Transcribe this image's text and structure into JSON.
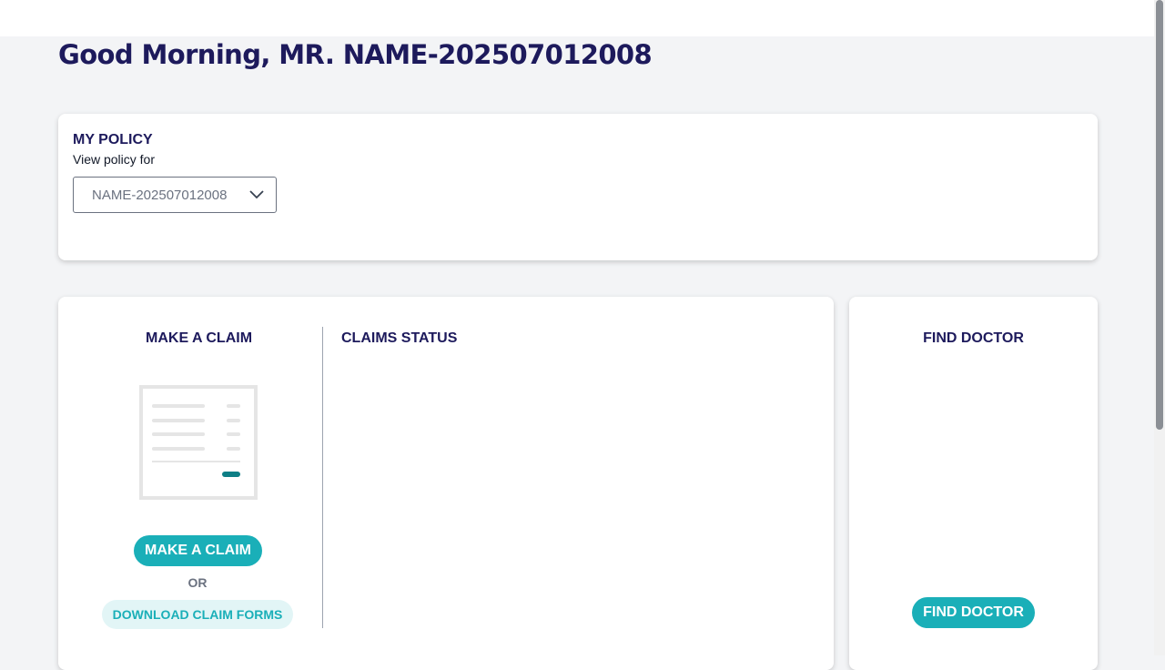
{
  "greeting": "Good Morning, MR. NAME-202507012008",
  "policy": {
    "title": "MY POLICY",
    "subtitle": "View policy for",
    "selected": "NAME-202507012008"
  },
  "claims": {
    "make_claim_title": "MAKE A CLAIM",
    "make_claim_button": "MAKE A CLAIM",
    "or_text": "OR",
    "download_forms_button": "DOWNLOAD CLAIM FORMS",
    "status_title": "CLAIMS STATUS"
  },
  "doctor": {
    "title": "FIND DOCTOR",
    "button": "FIND DOCTOR"
  },
  "colors": {
    "heading": "#1d1a5c",
    "accent": "#1aafb8",
    "accent_light": "#e2f5f6",
    "background": "#f3f4f6"
  },
  "icons": {
    "policy_select": "chevron-down-icon",
    "claim_illustration": "claim-document-icon"
  }
}
